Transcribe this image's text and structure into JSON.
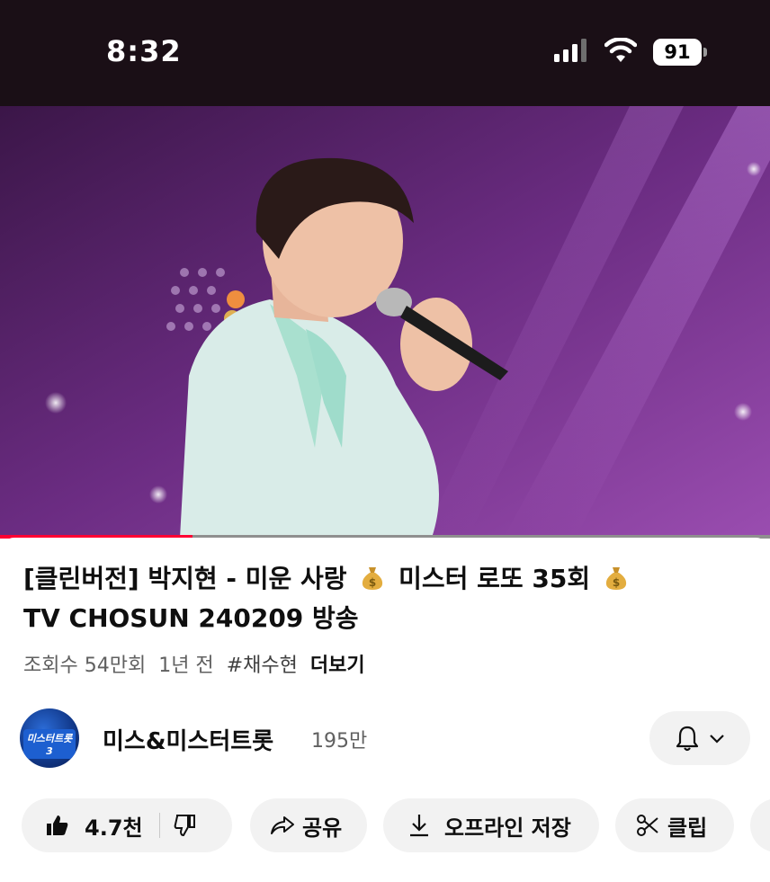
{
  "status_bar": {
    "time": "8:32",
    "battery": "91",
    "icons": [
      "cellular-signal-icon",
      "wifi-icon",
      "battery-icon"
    ]
  },
  "video": {
    "description_icon": "video-player",
    "progress": 0.25,
    "progress_color": "#ff0033"
  },
  "video_info": {
    "title_part1": "[클린버전] 박지현 - 미운 사랑",
    "title_part2": "미스터 로또 35회",
    "title_part3": "TV CHOSUN 240209 방송",
    "title_emoji": "money-bag-icon",
    "views": "조회수 54만회",
    "age": "1년 전",
    "hashtag": "#채수현",
    "more": "더보기"
  },
  "channel": {
    "avatar_text": "미스터트롯3",
    "name": "미스&미스터트롯",
    "subscribers": "195만"
  },
  "actions": {
    "like_count": "4.7천",
    "share": "공유",
    "offline_save": "오프라인 저장",
    "clip": "클립"
  },
  "colors": {
    "accent": "#ff0033",
    "pill_bg": "#f2f2f2",
    "status_bg": "#1a0f16"
  }
}
